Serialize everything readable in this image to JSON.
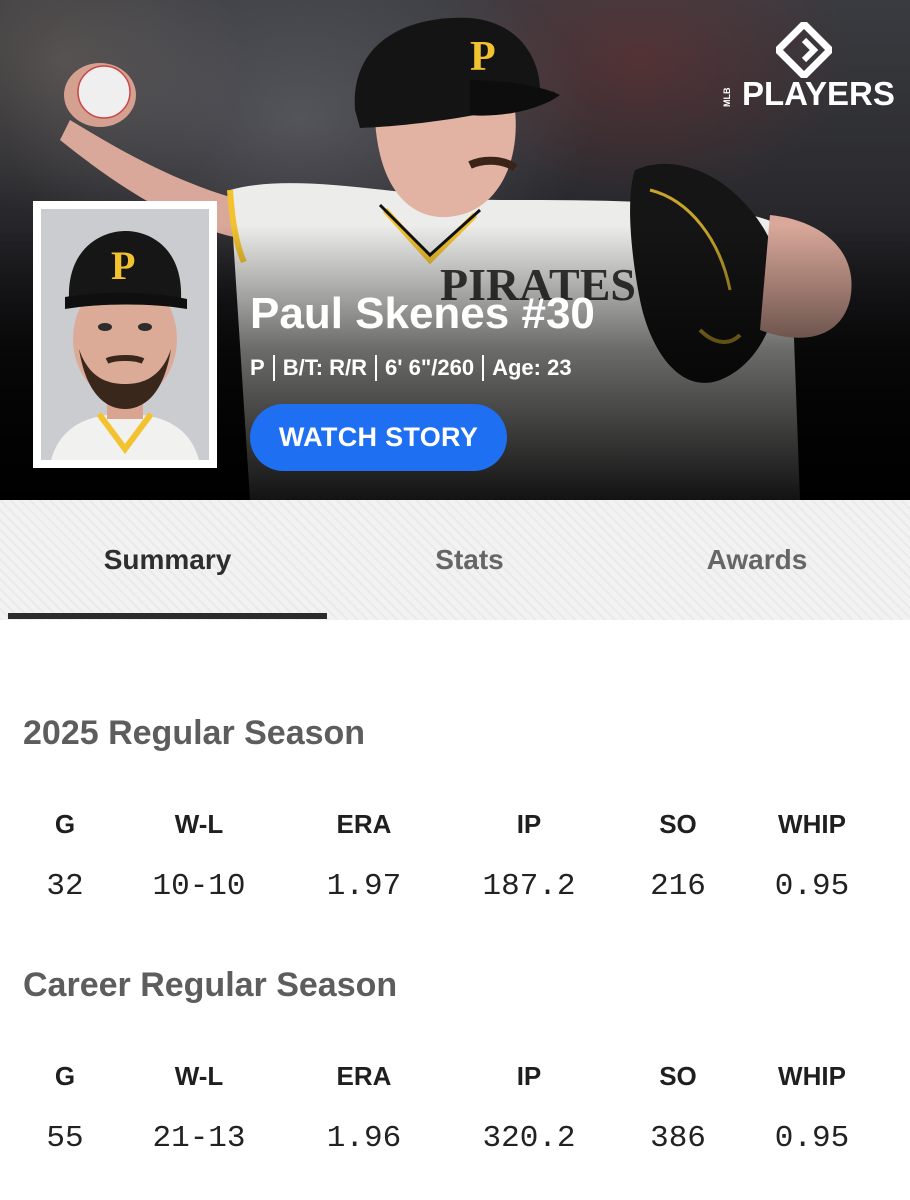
{
  "brand": {
    "wordmark": "PLAYERS",
    "sub": "MLB"
  },
  "player": {
    "name": "Paul Skenes #30",
    "position": "P",
    "bats_throws": "B/T: R/R",
    "height_weight": "6' 6\"/260",
    "age": "Age: 23",
    "cap_letter": "P"
  },
  "cta": {
    "label": "WATCH STORY"
  },
  "tabs": [
    {
      "label": "Summary",
      "active": true
    },
    {
      "label": "Stats",
      "active": false
    },
    {
      "label": "Awards",
      "active": false
    }
  ],
  "sections": [
    {
      "title": "2025 Regular Season",
      "headers": [
        "G",
        "W-L",
        "ERA",
        "IP",
        "SO",
        "WHIP"
      ],
      "values": [
        "32",
        "10-10",
        "1.97",
        "187.2",
        "216",
        "0.95"
      ]
    },
    {
      "title": "Career Regular Season",
      "headers": [
        "G",
        "W-L",
        "ERA",
        "IP",
        "SO",
        "WHIP"
      ],
      "values": [
        "55",
        "21-13",
        "1.96",
        "320.2",
        "386",
        "0.95"
      ]
    }
  ],
  "colors": {
    "accent": "#1f6ff2",
    "team_gold": "#f2c230",
    "team_black": "#111111"
  }
}
